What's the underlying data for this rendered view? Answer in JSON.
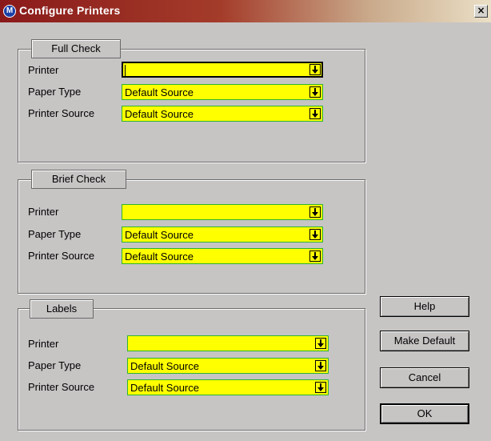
{
  "window": {
    "title": "Configure Printers",
    "close_glyph": "×"
  },
  "groups": [
    {
      "legend": "Full Check",
      "rows": [
        {
          "label": "Printer",
          "value": ""
        },
        {
          "label": "Paper Type",
          "value": "Default Source"
        },
        {
          "label": "Printer Source",
          "value": "Default Source"
        }
      ]
    },
    {
      "legend": "Brief Check",
      "rows": [
        {
          "label": "Printer",
          "value": ""
        },
        {
          "label": "Paper Type",
          "value": "Default Source"
        },
        {
          "label": "Printer Source",
          "value": "Default Source"
        }
      ]
    },
    {
      "legend": "Labels",
      "rows": [
        {
          "label": "Printer",
          "value": ""
        },
        {
          "label": "Paper Type",
          "value": "Default Source"
        },
        {
          "label": "Printer Source",
          "value": "Default Source"
        }
      ]
    }
  ],
  "buttons": {
    "help": "Help",
    "make_default": "Make Default",
    "cancel": "Cancel",
    "ok": "OK"
  },
  "icons": {
    "app": "app-logo-icon",
    "dropdown": "dropdown-arrow-icon",
    "close": "close-icon"
  },
  "colors": {
    "title_start": "#8a1a1a",
    "field_bg": "#ffff00",
    "field_border": "#2db52d",
    "dialog_bg": "#c7c4c4"
  }
}
